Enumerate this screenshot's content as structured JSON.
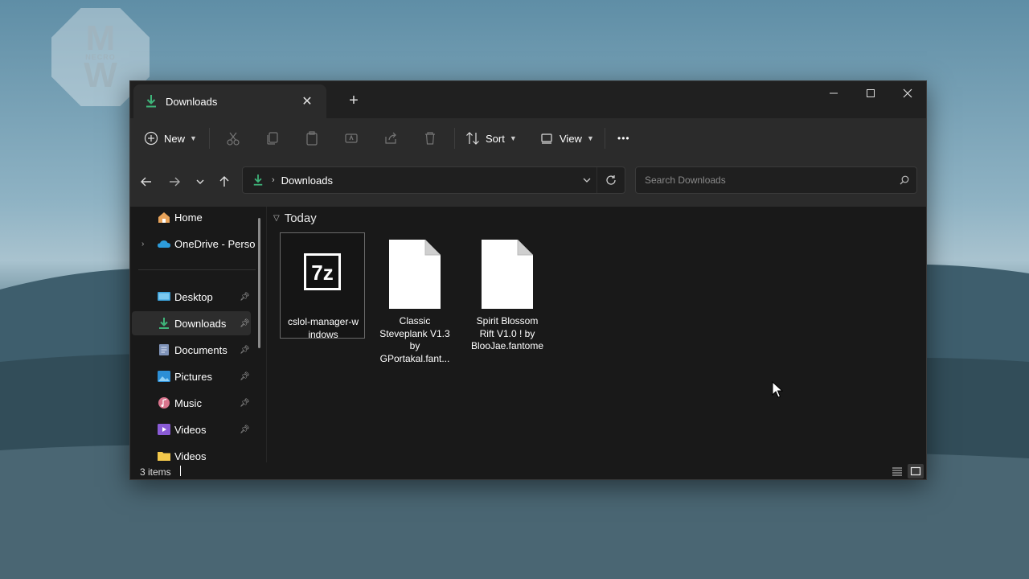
{
  "watermark": {
    "line1": "M",
    "line2": "NECRO",
    "line3": "W"
  },
  "titlebar": {
    "tab_label": "Downloads",
    "tab_close": "✕",
    "new_tab": "+"
  },
  "toolbar": {
    "new_label": "New",
    "sort_label": "Sort",
    "view_label": "View",
    "more_label": "•••"
  },
  "address": {
    "path": "Downloads",
    "search_placeholder": "Search Downloads"
  },
  "sidebar": {
    "items": [
      {
        "label": "Home",
        "icon": "home-icon"
      },
      {
        "label": "OneDrive - Persor",
        "icon": "onedrive-icon"
      },
      {
        "label": "Desktop",
        "icon": "desktop-icon",
        "pinned": true
      },
      {
        "label": "Downloads",
        "icon": "download-icon",
        "pinned": true,
        "selected": true
      },
      {
        "label": "Documents",
        "icon": "documents-icon",
        "pinned": true
      },
      {
        "label": "Pictures",
        "icon": "pictures-icon",
        "pinned": true
      },
      {
        "label": "Music",
        "icon": "music-icon",
        "pinned": true
      },
      {
        "label": "Videos",
        "icon": "videos-icon",
        "pinned": true
      },
      {
        "label": "Videos",
        "icon": "folder-icon"
      }
    ]
  },
  "content": {
    "group_label": "Today",
    "files": [
      {
        "name": "cslol-manager-windows",
        "name_display": "cslol-manager-w\nindows",
        "icon": "7z-archive-icon",
        "icon_text": "7z",
        "selected": true
      },
      {
        "name": "Classic Steveplank V1.3 by GPortakal.fantome",
        "name_display": "Classic\nSteveplank V1.3\nby\nGPortakal.fant...",
        "icon": "file-icon"
      },
      {
        "name": "Spirit Blossom Rift V1.0 ! by BlooJae.fantome",
        "name_display": "Spirit Blossom\nRift V1.0 ! by\nBlooJae.fantome",
        "icon": "file-icon"
      }
    ]
  },
  "status": {
    "item_count": "3 items"
  },
  "colors": {
    "accent_green": "#3fb57a",
    "window_bg": "#191919",
    "toolbar_bg": "#2b2b2b"
  }
}
